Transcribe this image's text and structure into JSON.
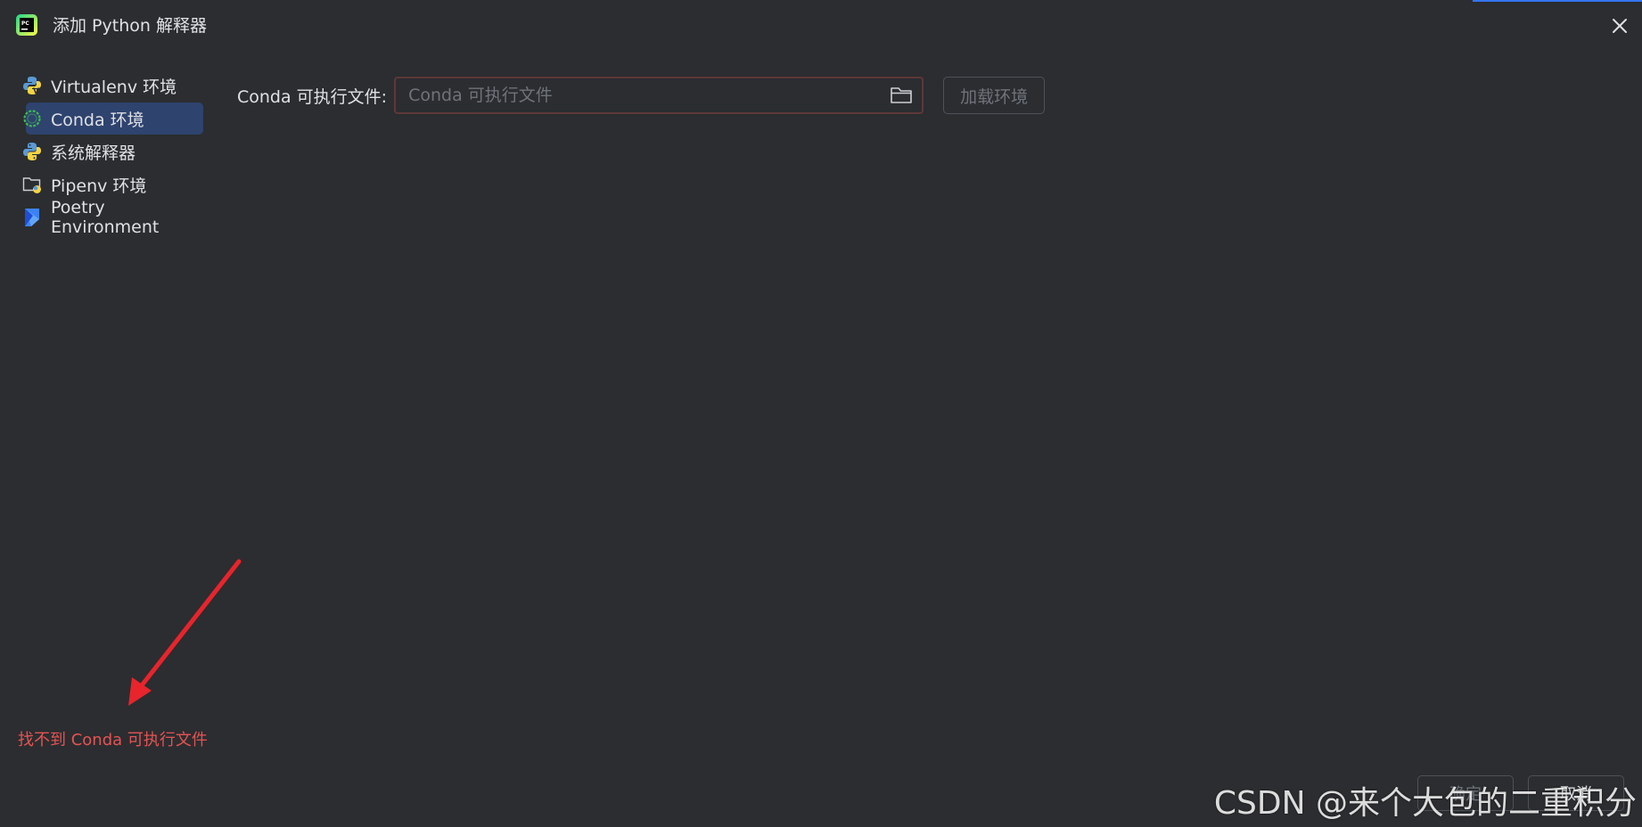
{
  "window": {
    "title": "添加 Python 解释器",
    "accent_color": "#3574f0"
  },
  "sidebar": {
    "items": [
      {
        "label": "Virtualenv 环境",
        "icon": "virtualenv-icon",
        "selected": false
      },
      {
        "label": "Conda 环境",
        "icon": "conda-icon",
        "selected": true
      },
      {
        "label": "系统解释器",
        "icon": "python-icon",
        "selected": false
      },
      {
        "label": "Pipenv 环境",
        "icon": "pipenv-folder-icon",
        "selected": false
      },
      {
        "label": "Poetry Environment",
        "icon": "poetry-icon",
        "selected": false
      }
    ]
  },
  "main": {
    "conda_label": "Conda 可执行文件:",
    "conda_input_value": "",
    "conda_input_placeholder": "Conda 可执行文件",
    "load_button_label": "加载环境",
    "input_border_color": "#5e3838"
  },
  "status": {
    "error_text": "找不到 Conda 可执行文件",
    "error_color": "#e55353"
  },
  "footer": {
    "ok_label": "确定",
    "cancel_label": "取消"
  },
  "watermark": "CSDN @来个大包的二重积分"
}
